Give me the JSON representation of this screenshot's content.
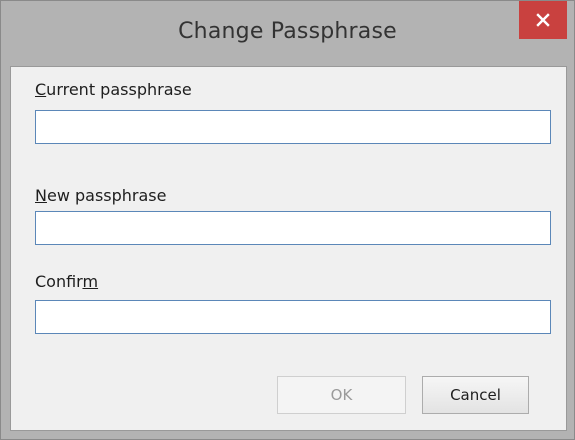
{
  "window": {
    "title": "Change Passphrase",
    "close_icon": "close-icon"
  },
  "form": {
    "current": {
      "label_accel": "C",
      "label_rest": "urrent passphrase",
      "value": ""
    },
    "new": {
      "label_accel": "N",
      "label_rest": "ew passphrase",
      "value": ""
    },
    "confirm": {
      "label_pre": "Confir",
      "label_accel": "m",
      "value": ""
    }
  },
  "buttons": {
    "ok_label": "OK",
    "ok_enabled": false,
    "cancel_label": "Cancel"
  },
  "colors": {
    "close_button": "#c9413f",
    "field_border": "#5b87b8",
    "frame": "#b3b3b3"
  }
}
